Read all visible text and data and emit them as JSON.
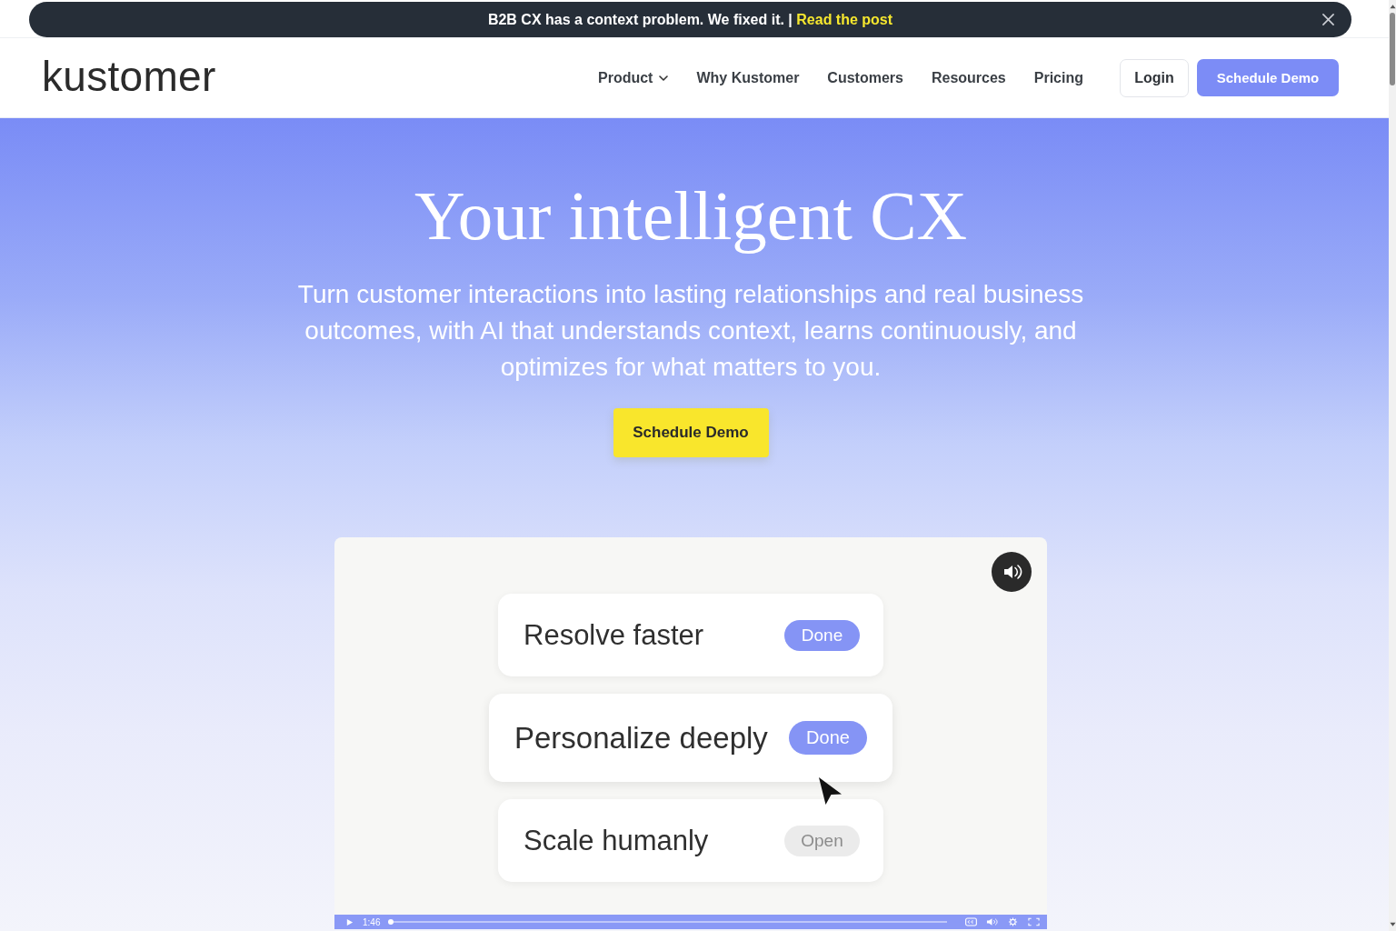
{
  "announcement": {
    "text": "B2B CX has a context problem. We fixed it. |",
    "link": "Read the post"
  },
  "header": {
    "logo": "kustomer",
    "nav": [
      {
        "label": "Product",
        "kind": "dropdown"
      },
      {
        "label": "Why Kustomer",
        "kind": "link"
      },
      {
        "label": "Customers",
        "kind": "link"
      },
      {
        "label": "Resources",
        "kind": "link"
      },
      {
        "label": "Pricing",
        "kind": "link"
      }
    ],
    "login": "Login",
    "cta": "Schedule Demo"
  },
  "hero": {
    "title": "Your intelligent CX",
    "subtitle": "Turn customer interactions into lasting relationships and real business outcomes, with AI that understands context, learns continuously, and optimizes for what matters to you.",
    "cta": "Schedule Demo"
  },
  "video": {
    "cards": [
      {
        "label": "Resolve faster",
        "badge": "Done",
        "done": true,
        "highlighted": false
      },
      {
        "label": "Personalize deeply",
        "badge": "Done",
        "done": true,
        "highlighted": true
      },
      {
        "label": "Scale humanly",
        "badge": "Open",
        "done": false,
        "highlighted": false
      }
    ],
    "time": "1:46",
    "progress": {
      "level": 0
    }
  }
}
